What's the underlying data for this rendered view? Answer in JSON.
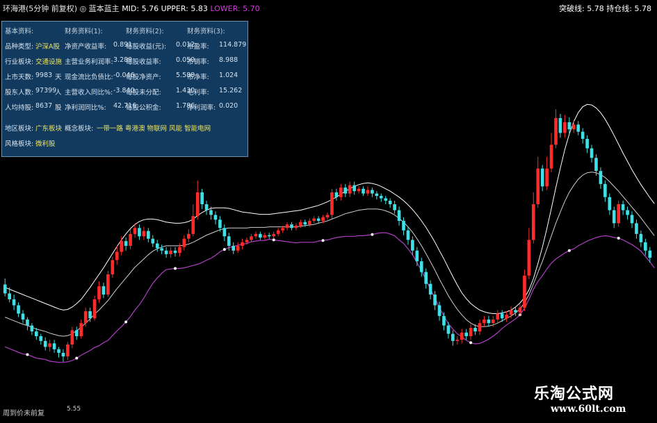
{
  "header": {
    "title": "环海港(5分钟 前复权)",
    "indicator": "◎ 蓝本蓝主",
    "mid": "MID: 5.76",
    "upper": "UPPER: 5.83",
    "lower": "LOWER: 5.70",
    "right_a": "突破线: 5.78",
    "right_b": "持仓线: 5.78"
  },
  "panel": {
    "headers": [
      "基本资料:",
      "财务资料(1):",
      "财务资料(2):",
      "财务资料(3):"
    ],
    "rows": [
      [
        {
          "k": "品种类型:",
          "v": "沪深A股"
        },
        {
          "k": "净资产收益率:",
          "v": "0.891"
        },
        {
          "k": "每股收益(元):",
          "v": "0.012"
        },
        {
          "k": "市盈率:",
          "v": "114.879"
        }
      ],
      [
        {
          "k": "行业板块:",
          "v": "交通设施"
        },
        {
          "k": "主营业务利润率:",
          "v": "3.289"
        },
        {
          "k": "每股收益率:",
          "v": "0.050"
        },
        {
          "k": "市销率:",
          "v": "8.988"
        }
      ],
      [
        {
          "k": "上市天数:",
          "v": "9983",
          "u": "天"
        },
        {
          "k": "现金流比负债比:",
          "v": "-0.046"
        },
        {
          "k": "每股净资产:",
          "v": "5.588"
        },
        {
          "k": "市净率:",
          "v": "1.024"
        }
      ],
      [
        {
          "k": "股东人数:",
          "v": "97399",
          "u": "人"
        },
        {
          "k": "主营收入同比%:",
          "v": "-3.840"
        },
        {
          "k": "每股未分配:",
          "v": "1.430"
        },
        {
          "k": "毛利率:",
          "v": "15.262"
        }
      ],
      [
        {
          "k": "人均持股:",
          "v": "8637",
          "u": "股"
        },
        {
          "k": "净利润同比%:",
          "v": "42.716"
        },
        {
          "k": "每股公积金:",
          "v": "1.786"
        },
        {
          "k": "净利润率:",
          "v": "0.020"
        }
      ]
    ],
    "region_k": "地区板块:",
    "region_v": "广东板块",
    "concept_k": "概念板块:",
    "concept_v": "一带一路 粤港澳 物联网 风能 智能电网",
    "style_k": "风格板块:",
    "style_v": "微利股"
  },
  "footer": {
    "left": "周到价未前复",
    "low_label": "5.55"
  },
  "watermark": {
    "line1": "乐淘公式网",
    "line2": "www.60lt.com"
  },
  "colors": {
    "up": "#ff2a2a",
    "down": "#3fe0e6",
    "mid": "#cfcfcf",
    "upper": "#ffffff",
    "lower": "#b23ec6"
  },
  "chart_data": {
    "type": "candlestick",
    "ylim": [
      5.5,
      6.02
    ],
    "candles": [
      [
        5.705,
        5.69,
        5.715,
        5.685
      ],
      [
        5.69,
        5.68,
        5.7,
        5.675
      ],
      [
        5.68,
        5.67,
        5.688,
        5.662
      ],
      [
        5.67,
        5.656,
        5.675,
        5.65
      ],
      [
        5.656,
        5.646,
        5.662,
        5.64
      ],
      [
        5.646,
        5.636,
        5.65,
        5.628
      ],
      [
        5.636,
        5.626,
        5.64,
        5.62
      ],
      [
        5.626,
        5.618,
        5.632,
        5.612
      ],
      [
        5.618,
        5.61,
        5.622,
        5.604
      ],
      [
        5.61,
        5.6,
        5.616,
        5.594
      ],
      [
        5.6,
        5.606,
        5.612,
        5.592
      ],
      [
        5.606,
        5.596,
        5.612,
        5.59
      ],
      [
        5.596,
        5.59,
        5.6,
        5.582
      ],
      [
        5.59,
        5.584,
        5.596,
        5.575
      ],
      [
        5.584,
        5.604,
        5.608,
        5.578
      ],
      [
        5.604,
        5.628,
        5.634,
        5.598
      ],
      [
        5.628,
        5.618,
        5.634,
        5.612
      ],
      [
        5.618,
        5.64,
        5.646,
        5.614
      ],
      [
        5.64,
        5.66,
        5.666,
        5.634
      ],
      [
        5.66,
        5.648,
        5.666,
        5.642
      ],
      [
        5.648,
        5.68,
        5.686,
        5.644
      ],
      [
        5.68,
        5.702,
        5.71,
        5.674
      ],
      [
        5.702,
        5.688,
        5.708,
        5.682
      ],
      [
        5.688,
        5.722,
        5.728,
        5.684
      ],
      [
        5.722,
        5.746,
        5.752,
        5.716
      ],
      [
        5.746,
        5.76,
        5.77,
        5.738
      ],
      [
        5.76,
        5.778,
        5.786,
        5.754
      ],
      [
        5.778,
        5.77,
        5.784,
        5.762
      ],
      [
        5.77,
        5.79,
        5.798,
        5.764
      ],
      [
        5.79,
        5.8,
        5.808,
        5.784
      ],
      [
        5.8,
        5.786,
        5.806,
        5.78
      ],
      [
        5.786,
        5.795,
        5.802,
        5.78
      ],
      [
        5.795,
        5.782,
        5.8,
        5.776
      ],
      [
        5.782,
        5.774,
        5.788,
        5.768
      ],
      [
        5.774,
        5.766,
        5.78,
        5.76
      ],
      [
        5.766,
        5.762,
        5.772,
        5.756
      ],
      [
        5.762,
        5.756,
        5.768,
        5.75
      ],
      [
        5.756,
        5.762,
        5.768,
        5.75
      ],
      [
        5.762,
        5.758,
        5.768,
        5.752
      ],
      [
        5.758,
        5.768,
        5.774,
        5.752
      ],
      [
        5.768,
        5.782,
        5.788,
        5.762
      ],
      [
        5.782,
        5.79,
        5.798,
        5.776
      ],
      [
        5.79,
        5.82,
        5.84,
        5.786
      ],
      [
        5.82,
        5.86,
        5.88,
        5.814
      ],
      [
        5.86,
        5.84,
        5.866,
        5.832
      ],
      [
        5.84,
        5.83,
        5.846,
        5.822
      ],
      [
        5.83,
        5.822,
        5.836,
        5.814
      ],
      [
        5.822,
        5.814,
        5.828,
        5.806
      ],
      [
        5.814,
        5.8,
        5.82,
        5.794
      ],
      [
        5.8,
        5.786,
        5.806,
        5.778
      ],
      [
        5.786,
        5.77,
        5.792,
        5.762
      ],
      [
        5.77,
        5.762,
        5.776,
        5.756
      ],
      [
        5.762,
        5.77,
        5.776,
        5.758
      ],
      [
        5.77,
        5.776,
        5.782,
        5.764
      ],
      [
        5.776,
        5.78,
        5.784,
        5.772
      ],
      [
        5.78,
        5.786,
        5.79,
        5.776
      ],
      [
        5.786,
        5.79,
        5.794,
        5.782
      ],
      [
        5.79,
        5.784,
        5.794,
        5.78
      ],
      [
        5.784,
        5.788,
        5.792,
        5.78
      ],
      [
        5.788,
        5.786,
        5.792,
        5.782
      ],
      [
        5.786,
        5.79,
        5.794,
        5.782
      ],
      [
        5.79,
        5.796,
        5.8,
        5.786
      ],
      [
        5.796,
        5.8,
        5.804,
        5.792
      ],
      [
        5.8,
        5.806,
        5.81,
        5.796
      ],
      [
        5.806,
        5.8,
        5.81,
        5.796
      ],
      [
        5.8,
        5.804,
        5.808,
        5.796
      ],
      [
        5.804,
        5.81,
        5.814,
        5.8
      ],
      [
        5.81,
        5.806,
        5.814,
        5.802
      ],
      [
        5.806,
        5.812,
        5.816,
        5.802
      ],
      [
        5.812,
        5.816,
        5.82,
        5.808
      ],
      [
        5.816,
        5.812,
        5.82,
        5.808
      ],
      [
        5.812,
        5.818,
        5.822,
        5.808
      ],
      [
        5.818,
        5.822,
        5.826,
        5.814
      ],
      [
        5.822,
        5.86,
        5.866,
        5.816
      ],
      [
        5.86,
        5.852,
        5.866,
        5.846
      ],
      [
        5.852,
        5.868,
        5.874,
        5.846
      ],
      [
        5.868,
        5.858,
        5.874,
        5.852
      ],
      [
        5.858,
        5.872,
        5.878,
        5.852
      ],
      [
        5.872,
        5.862,
        5.878,
        5.856
      ],
      [
        5.862,
        5.866,
        5.87,
        5.858
      ],
      [
        5.866,
        5.858,
        5.87,
        5.854
      ],
      [
        5.858,
        5.864,
        5.87,
        5.854
      ],
      [
        5.864,
        5.858,
        5.868,
        5.852
      ],
      [
        5.858,
        5.854,
        5.862,
        5.848
      ],
      [
        5.854,
        5.85,
        5.858,
        5.844
      ],
      [
        5.85,
        5.846,
        5.854,
        5.84
      ],
      [
        5.846,
        5.84,
        5.85,
        5.834
      ],
      [
        5.84,
        5.83,
        5.846,
        5.824
      ],
      [
        5.83,
        5.812,
        5.836,
        5.804
      ],
      [
        5.812,
        5.796,
        5.818,
        5.788
      ],
      [
        5.796,
        5.78,
        5.802,
        5.772
      ],
      [
        5.78,
        5.762,
        5.786,
        5.754
      ],
      [
        5.762,
        5.744,
        5.768,
        5.736
      ],
      [
        5.744,
        5.726,
        5.75,
        5.718
      ],
      [
        5.726,
        5.706,
        5.732,
        5.698
      ],
      [
        5.706,
        5.688,
        5.712,
        5.68
      ],
      [
        5.688,
        5.67,
        5.694,
        5.662
      ],
      [
        5.67,
        5.652,
        5.676,
        5.644
      ],
      [
        5.652,
        5.636,
        5.658,
        5.628
      ],
      [
        5.636,
        5.622,
        5.642,
        5.614
      ],
      [
        5.622,
        5.61,
        5.628,
        5.602
      ],
      [
        5.61,
        5.612,
        5.618,
        5.604
      ],
      [
        5.612,
        5.624,
        5.63,
        5.606
      ],
      [
        5.624,
        5.618,
        5.63,
        5.612
      ],
      [
        5.618,
        5.632,
        5.638,
        5.612
      ],
      [
        5.632,
        5.626,
        5.638,
        5.62
      ],
      [
        5.626,
        5.64,
        5.646,
        5.62
      ],
      [
        5.64,
        5.646,
        5.652,
        5.634
      ],
      [
        5.646,
        5.64,
        5.652,
        5.634
      ],
      [
        5.64,
        5.646,
        5.652,
        5.634
      ],
      [
        5.646,
        5.656,
        5.662,
        5.64
      ],
      [
        5.656,
        5.648,
        5.662,
        5.642
      ],
      [
        5.648,
        5.654,
        5.66,
        5.642
      ],
      [
        5.654,
        5.662,
        5.668,
        5.648
      ],
      [
        5.662,
        5.658,
        5.668,
        5.652
      ],
      [
        5.658,
        5.666,
        5.672,
        5.652
      ],
      [
        5.666,
        5.72,
        5.73,
        5.66
      ],
      [
        5.72,
        5.78,
        5.8,
        5.714
      ],
      [
        5.78,
        5.84,
        5.86,
        5.774
      ],
      [
        5.84,
        5.9,
        5.92,
        5.834
      ],
      [
        5.9,
        5.87,
        5.906,
        5.862
      ],
      [
        5.87,
        5.9,
        5.92,
        5.864
      ],
      [
        5.9,
        5.94,
        5.96,
        5.894
      ],
      [
        5.94,
        5.985,
        6.0,
        5.934
      ],
      [
        5.985,
        5.96,
        5.992,
        5.952
      ],
      [
        5.96,
        5.978,
        5.99,
        5.952
      ],
      [
        5.978,
        5.966,
        5.986,
        5.958
      ],
      [
        5.966,
        5.974,
        5.982,
        5.96
      ],
      [
        5.974,
        5.962,
        5.98,
        5.956
      ],
      [
        5.962,
        5.95,
        5.968,
        5.942
      ],
      [
        5.95,
        5.934,
        5.956,
        5.926
      ],
      [
        5.934,
        5.918,
        5.94,
        5.91
      ],
      [
        5.918,
        5.896,
        5.924,
        5.888
      ],
      [
        5.896,
        5.874,
        5.902,
        5.866
      ],
      [
        5.874,
        5.852,
        5.88,
        5.844
      ],
      [
        5.852,
        5.83,
        5.858,
        5.822
      ],
      [
        5.83,
        5.808,
        5.836,
        5.8
      ],
      [
        5.808,
        5.84,
        5.846,
        5.802
      ],
      [
        5.84,
        5.83,
        5.846,
        5.822
      ],
      [
        5.83,
        5.822,
        5.836,
        5.814
      ],
      [
        5.822,
        5.808,
        5.828,
        5.8
      ],
      [
        5.808,
        5.79,
        5.814,
        5.782
      ],
      [
        5.79,
        5.776,
        5.796,
        5.768
      ],
      [
        5.776,
        5.762,
        5.782,
        5.754
      ],
      [
        5.762,
        5.75,
        5.768,
        5.742
      ]
    ],
    "mid": [
      5.65,
      5.647,
      5.644,
      5.641,
      5.638,
      5.636,
      5.633,
      5.63,
      5.628,
      5.626,
      5.623,
      5.621,
      5.619,
      5.618,
      5.619,
      5.622,
      5.627,
      5.633,
      5.64,
      5.647,
      5.655,
      5.662,
      5.67,
      5.678,
      5.688,
      5.698,
      5.707,
      5.716,
      5.725,
      5.734,
      5.741,
      5.748,
      5.755,
      5.761,
      5.765,
      5.768,
      5.77,
      5.77,
      5.77,
      5.77,
      5.771,
      5.773,
      5.776,
      5.78,
      5.784,
      5.788,
      5.791,
      5.794,
      5.797,
      5.799,
      5.8,
      5.8,
      5.8,
      5.8,
      5.8,
      5.801,
      5.801,
      5.801,
      5.801,
      5.802,
      5.802,
      5.802,
      5.802,
      5.802,
      5.802,
      5.802,
      5.803,
      5.804,
      5.805,
      5.806,
      5.808,
      5.81,
      5.812,
      5.815,
      5.818,
      5.821,
      5.824,
      5.826,
      5.828,
      5.83,
      5.831,
      5.832,
      5.832,
      5.832,
      5.831,
      5.829,
      5.826,
      5.822,
      5.816,
      5.81,
      5.802,
      5.793,
      5.782,
      5.77,
      5.757,
      5.743,
      5.729,
      5.714,
      5.7,
      5.686,
      5.674,
      5.663,
      5.654,
      5.646,
      5.64,
      5.636,
      5.634,
      5.634,
      5.635,
      5.637,
      5.64,
      5.644,
      5.648,
      5.652,
      5.657,
      5.664,
      5.674,
      5.688,
      5.706,
      5.725,
      5.744,
      5.765,
      5.787,
      5.808,
      5.827,
      5.845,
      5.86,
      5.872,
      5.882,
      5.889,
      5.893,
      5.894,
      5.893,
      5.89,
      5.885,
      5.878,
      5.87,
      5.862,
      5.853,
      5.844,
      5.835,
      5.826,
      5.817,
      5.807,
      5.797,
      5.787
    ],
    "upper": [
      5.7,
      5.697,
      5.694,
      5.691,
      5.688,
      5.685,
      5.682,
      5.679,
      5.676,
      5.673,
      5.67,
      5.667,
      5.664,
      5.662,
      5.663,
      5.667,
      5.673,
      5.68,
      5.69,
      5.7,
      5.711,
      5.722,
      5.733,
      5.745,
      5.757,
      5.769,
      5.78,
      5.79,
      5.799,
      5.806,
      5.811,
      5.814,
      5.815,
      5.815,
      5.814,
      5.812,
      5.81,
      5.809,
      5.808,
      5.808,
      5.809,
      5.811,
      5.815,
      5.821,
      5.826,
      5.83,
      5.833,
      5.834,
      5.834,
      5.834,
      5.833,
      5.831,
      5.829,
      5.827,
      5.826,
      5.825,
      5.824,
      5.823,
      5.823,
      5.823,
      5.824,
      5.825,
      5.826,
      5.827,
      5.828,
      5.829,
      5.83,
      5.832,
      5.834,
      5.836,
      5.838,
      5.841,
      5.844,
      5.848,
      5.852,
      5.857,
      5.862,
      5.866,
      5.87,
      5.873,
      5.875,
      5.876,
      5.875,
      5.873,
      5.87,
      5.866,
      5.862,
      5.857,
      5.852,
      5.846,
      5.839,
      5.831,
      5.822,
      5.812,
      5.801,
      5.789,
      5.776,
      5.762,
      5.748,
      5.733,
      5.718,
      5.704,
      5.691,
      5.681,
      5.673,
      5.667,
      5.662,
      5.659,
      5.657,
      5.656,
      5.656,
      5.657,
      5.659,
      5.662,
      5.667,
      5.674,
      5.683,
      5.696,
      5.715,
      5.74,
      5.768,
      5.799,
      5.833,
      5.868,
      5.901,
      5.932,
      5.958,
      5.979,
      5.994,
      6.004,
      6.008,
      6.007,
      6.002,
      5.994,
      5.983,
      5.97,
      5.956,
      5.941,
      5.926,
      5.912,
      5.898,
      5.885,
      5.873,
      5.862,
      5.851,
      5.841
    ],
    "lower": [
      5.6,
      5.597,
      5.594,
      5.591,
      5.588,
      5.587,
      5.584,
      5.581,
      5.58,
      5.579,
      5.576,
      5.575,
      5.574,
      5.574,
      5.575,
      5.577,
      5.581,
      5.586,
      5.59,
      5.594,
      5.599,
      5.602,
      5.607,
      5.611,
      5.619,
      5.627,
      5.634,
      5.642,
      5.651,
      5.662,
      5.671,
      5.682,
      5.695,
      5.707,
      5.716,
      5.724,
      5.73,
      5.731,
      5.732,
      5.732,
      5.733,
      5.735,
      5.737,
      5.739,
      5.742,
      5.746,
      5.749,
      5.754,
      5.76,
      5.764,
      5.767,
      5.769,
      5.771,
      5.773,
      5.774,
      5.777,
      5.778,
      5.779,
      5.779,
      5.781,
      5.78,
      5.779,
      5.778,
      5.777,
      5.776,
      5.775,
      5.776,
      5.776,
      5.776,
      5.776,
      5.778,
      5.779,
      5.78,
      5.782,
      5.784,
      5.785,
      5.786,
      5.786,
      5.786,
      5.787,
      5.787,
      5.788,
      5.789,
      5.791,
      5.792,
      5.792,
      5.79,
      5.787,
      5.78,
      5.774,
      5.765,
      5.755,
      5.742,
      5.728,
      5.713,
      5.697,
      5.682,
      5.666,
      5.652,
      5.639,
      5.63,
      5.622,
      5.617,
      5.611,
      5.607,
      5.605,
      5.606,
      5.609,
      5.613,
      5.618,
      5.624,
      5.631,
      5.637,
      5.642,
      5.647,
      5.654,
      5.665,
      5.68,
      5.697,
      5.71,
      5.72,
      5.731,
      5.741,
      5.748,
      5.753,
      5.758,
      5.762,
      5.765,
      5.77,
      5.774,
      5.778,
      5.781,
      5.784,
      5.786,
      5.787,
      5.786,
      5.784,
      5.783,
      5.78,
      5.776,
      5.772,
      5.767,
      5.761,
      5.752,
      5.743,
      5.733
    ]
  }
}
